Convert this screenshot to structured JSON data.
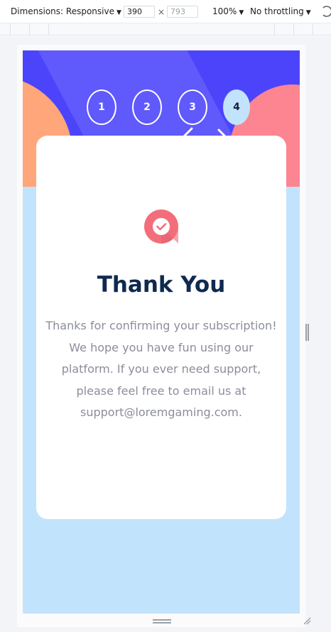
{
  "devtools": {
    "dimensions_label": "Dimensions: Responsive",
    "width_value": "390",
    "height_placeholder": "793",
    "times": "×",
    "zoom": "100%",
    "throttling": "No throttling"
  },
  "steps": [
    {
      "label": "1",
      "active": false
    },
    {
      "label": "2",
      "active": false
    },
    {
      "label": "3",
      "active": false
    },
    {
      "label": "4",
      "active": true
    }
  ],
  "card": {
    "icon": "check-badge-icon",
    "title": "Thank You",
    "body": "Thanks for confirming your subscription! We hope you have fun using our platform. If you ever need support, please feel free to email us at support@loremgaming.com."
  },
  "colors": {
    "header_blue": "#4c44fb",
    "blob_orange": "#ffa67a",
    "blob_pink": "#fd8491",
    "page_light_blue": "#c2e3fc",
    "title_navy": "#0f2a4f",
    "body_gray": "#8b8e9b",
    "icon_red": "#f36e7b"
  }
}
